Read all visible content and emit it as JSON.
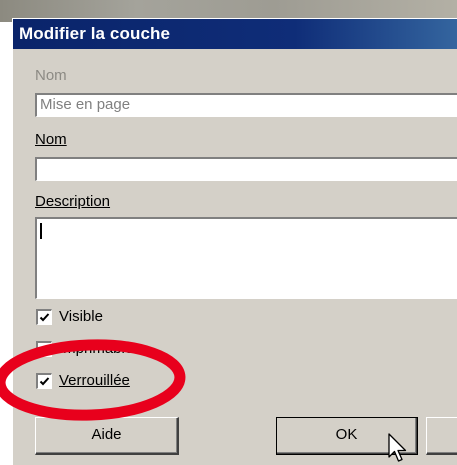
{
  "dialog": {
    "title": "Modifier la couche",
    "nom_original_label": "Nom",
    "nom_original_value": "Mise en page",
    "nom_label": "Nom",
    "nom_value": "",
    "description_label": "Description",
    "description_value": "",
    "checkboxes": [
      {
        "label": "Visible",
        "checked": true
      },
      {
        "label": "Imprimable",
        "checked": true
      },
      {
        "label": "Verrouillée",
        "checked": true
      }
    ],
    "buttons": {
      "help": "Aide",
      "ok": "OK",
      "cancel": ""
    }
  },
  "icons": {
    "cursor": "mouse-pointer-icon",
    "check": "checkmark-icon"
  },
  "annotation": {
    "color": "#e8001c",
    "shape": "ellipse"
  },
  "colors": {
    "titlebar": "#0a246a",
    "dialog_bg": "#d4d0c8"
  }
}
